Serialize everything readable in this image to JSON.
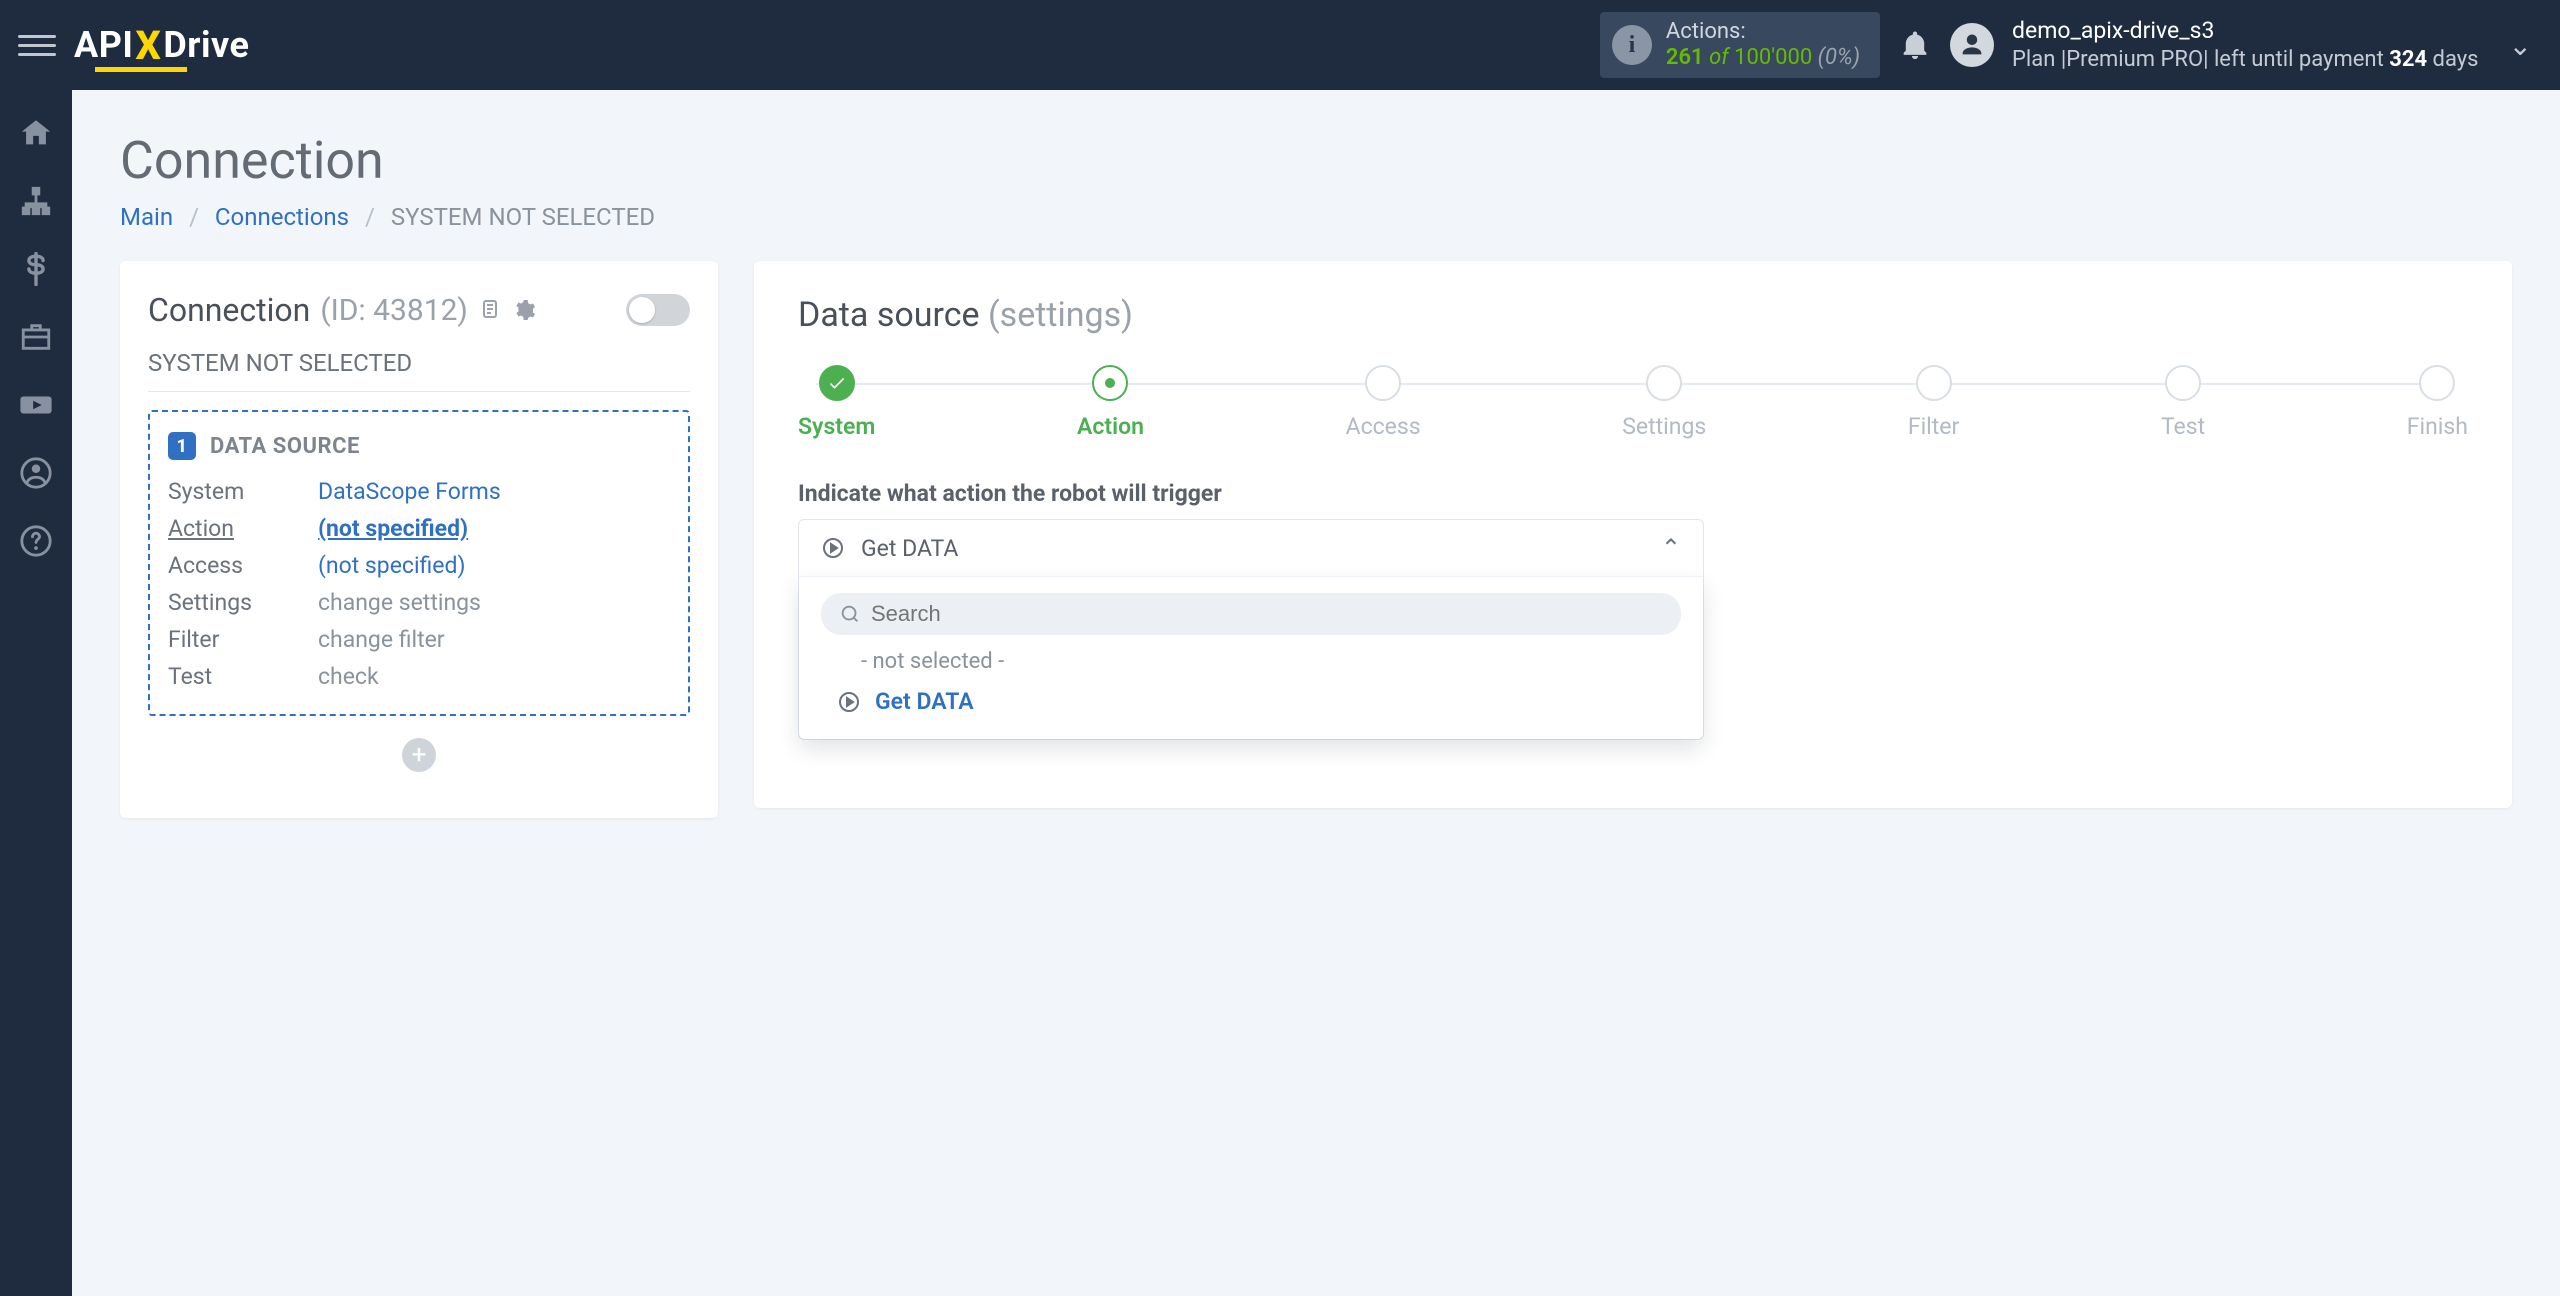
{
  "header": {
    "actions": {
      "label": "Actions:",
      "used": "261",
      "of": "of",
      "total": "100'000",
      "pct": "(0%)"
    },
    "user": {
      "name": "demo_apix-drive_s3",
      "plan_prefix": "Plan  |",
      "plan_name": "Premium PRO",
      "plan_mid": "|  left until payment ",
      "days": "324",
      "plan_suffix": " days"
    }
  },
  "page": {
    "title": "Connection",
    "crumbs": {
      "main": "Main",
      "connections": "Connections",
      "current": "SYSTEM NOT SELECTED"
    }
  },
  "left": {
    "heading": "Connection",
    "id_label": "(ID: 43812)",
    "subtitle": "SYSTEM NOT SELECTED",
    "block_title": "DATA SOURCE",
    "badge": "1",
    "rows": {
      "system_k": "System",
      "system_v": "DataScope Forms",
      "action_k": "Action",
      "action_v": "(not specified)",
      "access_k": "Access",
      "access_v": "(not specified)",
      "settings_k": "Settings",
      "settings_v": "change settings",
      "filter_k": "Filter",
      "filter_v": "change filter",
      "test_k": "Test",
      "test_v": "check"
    }
  },
  "right": {
    "title_main": "Data source",
    "title_muted": "(settings)",
    "steps": [
      "System",
      "Action",
      "Access",
      "Settings",
      "Filter",
      "Test",
      "Finish"
    ],
    "prompt": "Indicate what action the robot will trigger",
    "selected": "Get DATA",
    "search_placeholder": "Search",
    "not_selected": "- not selected -",
    "option": "Get DATA"
  }
}
